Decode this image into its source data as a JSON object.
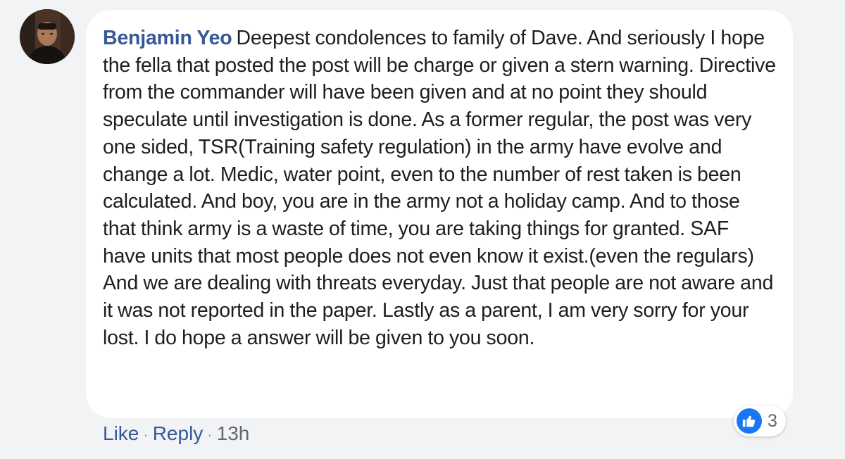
{
  "comment": {
    "author": "Benjamin Yeo",
    "text": "Deepest condolences to family of Dave. And seriously I hope the fella that posted the post will be charge or given a stern warning. Directive from the commander will have been given and at no point they should speculate until investigation is done. As a former regular, the post was very one sided, TSR(Training safety regulation) in the army have evolve and change a lot. Medic, water point, even to the number of rest taken is been calculated. And boy, you are in the army not a holiday camp. And to those that think army is a waste of time, you are taking things for granted. SAF have units that most people does not even know it exist.(even the regulars) And we are dealing with threats everyday. Just that people are not aware and it was not reported in the paper. Lastly as a parent, I am very sorry for your lost. I do hope a answer will be given to you soon.",
    "reactions": {
      "icon": "thumbs-up-icon",
      "count": "3",
      "color": "#1877f2"
    }
  },
  "actions": {
    "like_label": "Like",
    "reply_label": "Reply",
    "separator": "·",
    "timestamp": "13h"
  },
  "colors": {
    "page_background": "#f2f3f5",
    "bubble_background": "#ffffff",
    "author_link": "#385898",
    "body_text": "#1c1e21",
    "meta_text": "#606770"
  }
}
